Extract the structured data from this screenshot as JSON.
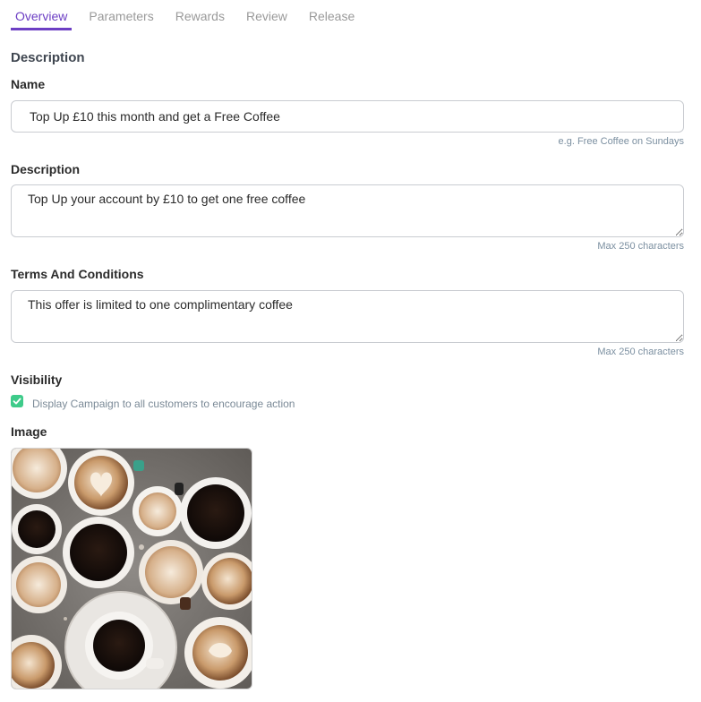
{
  "tabs": [
    {
      "label": "Overview",
      "active": true
    },
    {
      "label": "Parameters",
      "active": false
    },
    {
      "label": "Rewards",
      "active": false
    },
    {
      "label": "Review",
      "active": false
    },
    {
      "label": "Release",
      "active": false
    }
  ],
  "section_title": "Description",
  "name_field": {
    "label": "Name",
    "value": "Top Up £10 this month and get a Free Coffee",
    "hint": "e.g. Free Coffee on Sundays"
  },
  "description_field": {
    "label": "Description",
    "value": "Top Up your account by £10 to get one free coffee",
    "hint": "Max 250 characters"
  },
  "terms_field": {
    "label": "Terms And Conditions",
    "value": "This offer is limited to one complimentary coffee",
    "hint": "Max 250 characters"
  },
  "visibility": {
    "label": "Visibility",
    "checkbox_label": "Display Campaign to all customers to encourage action",
    "checked": true
  },
  "image_section": {
    "label": "Image"
  },
  "colors": {
    "accent": "#6d3fc4",
    "checkbox": "#3ecb8a",
    "hint": "#7b8fa0"
  }
}
